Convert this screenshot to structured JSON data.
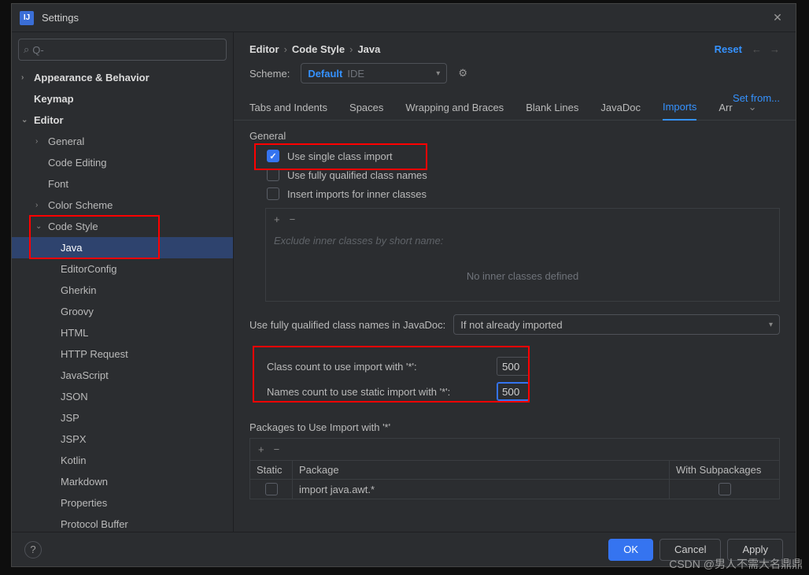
{
  "window": {
    "title": "Settings"
  },
  "search": {
    "placeholder": "Q-"
  },
  "tree": {
    "appearance": "Appearance & Behavior",
    "keymap": "Keymap",
    "editor": "Editor",
    "general": "General",
    "code_editing": "Code Editing",
    "font": "Font",
    "color_scheme": "Color Scheme",
    "code_style": "Code Style",
    "java": "Java",
    "editorconfig": "EditorConfig",
    "gherkin": "Gherkin",
    "groovy": "Groovy",
    "html": "HTML",
    "http_request": "HTTP Request",
    "javascript": "JavaScript",
    "json": "JSON",
    "jsp": "JSP",
    "jspx": "JSPX",
    "kotlin": "Kotlin",
    "markdown": "Markdown",
    "properties": "Properties",
    "protocol_buffer": "Protocol Buffer"
  },
  "breadcrumb": {
    "p0": "Editor",
    "p1": "Code Style",
    "p2": "Java"
  },
  "actions": {
    "reset": "Reset",
    "set_from": "Set from..."
  },
  "scheme": {
    "label": "Scheme:",
    "name": "Default",
    "tag": "IDE"
  },
  "tabs": {
    "tabs_indents": "Tabs and Indents",
    "spaces": "Spaces",
    "wrapping": "Wrapping and Braces",
    "blank_lines": "Blank Lines",
    "javadoc": "JavaDoc",
    "imports": "Imports",
    "arr": "Arr"
  },
  "general": {
    "header": "General",
    "use_single": "Use single class import",
    "use_fq": "Use fully qualified class names",
    "insert_inner": "Insert imports for inner classes",
    "exclude_hint": "Exclude inner classes by short name:",
    "exclude_empty": "No inner classes defined"
  },
  "javadoc": {
    "label": "Use fully qualified class names in JavaDoc:",
    "value": "If not already imported"
  },
  "counts": {
    "class_label": "Class count to use import with '*':",
    "class_value": "500",
    "names_label": "Names count to use static import with '*':",
    "names_value": "500"
  },
  "packages": {
    "header": "Packages to Use Import with '*'",
    "col_static": "Static",
    "col_package": "Package",
    "col_subs": "With Subpackages",
    "row0": "import java.awt.*"
  },
  "footer": {
    "ok": "OK",
    "cancel": "Cancel",
    "apply": "Apply"
  },
  "watermark": "CSDN @男人不需大名鼎鼎"
}
